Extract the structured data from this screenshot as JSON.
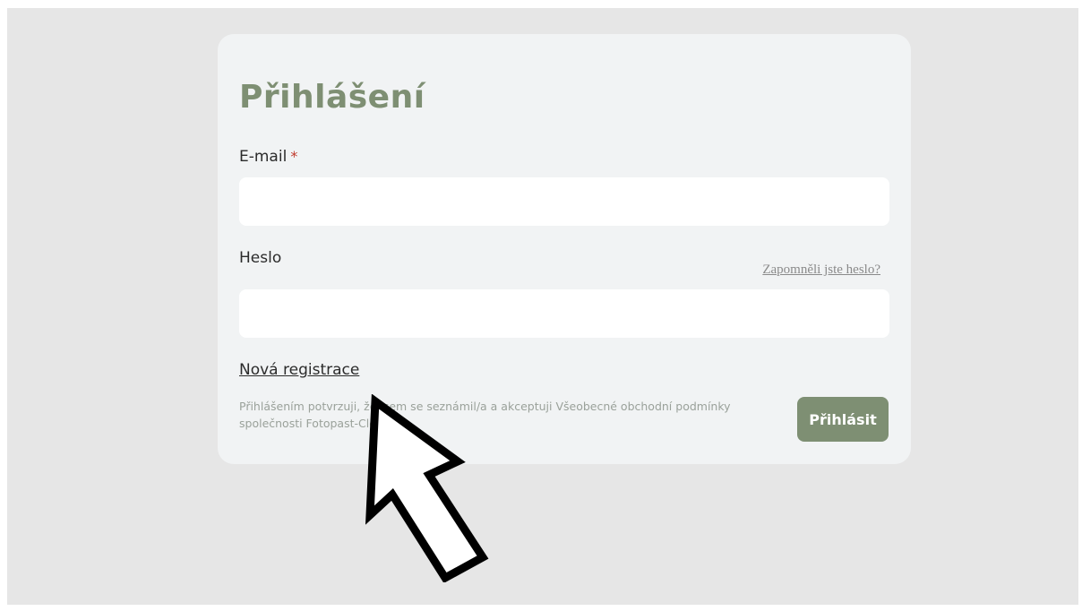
{
  "login": {
    "title": "Přihlášení",
    "email_label": "E-mail",
    "required_mark": "*",
    "email_value": "",
    "password_label": "Heslo",
    "password_value": "",
    "forgot_link": "Zapomněli jste heslo?",
    "register_link": "Nová registrace",
    "terms_text": "Přihlášením potvrzuji, že jsem se seznámil/a a akceptuji Všeobecné obchodní podmínky společnosti Fotopast-Cloud.cz.",
    "submit_label": "Přihlásit"
  },
  "colors": {
    "accent": "#7e8f73",
    "required": "#c0392b",
    "page_background": "#e6e6e6",
    "card_background": "#f1f3f4"
  },
  "icons": {
    "pointer": "arrow-pointer-icon"
  }
}
